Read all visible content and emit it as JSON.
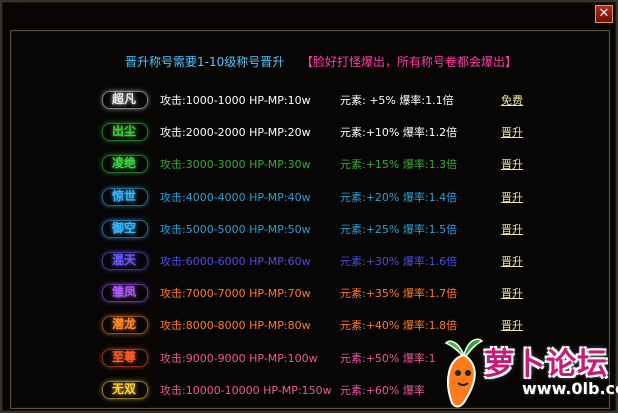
{
  "window": {
    "close_label": "✕"
  },
  "header": {
    "requirement": "晋升称号需要1-10级称号晋升",
    "notice": "【脸好打怪爆出，所有称号卷都会爆出】"
  },
  "titles": [
    {
      "name": "超凡",
      "attack": "攻击:1000-1000 HP-MP:10w",
      "element": "元素: +5% 爆率:1.1倍",
      "action": "免费",
      "color": "#e6e6e6",
      "text_color": "#ffffff"
    },
    {
      "name": "出尘",
      "attack": "攻击:2000-2000 HP-MP:20w",
      "element": "元素:+10% 爆率:1.2倍",
      "action": "晋升",
      "color": "#3fd23f",
      "text_color": "#ffffff"
    },
    {
      "name": "凌绝",
      "attack": "攻击:3000-3000 HP-MP:30w",
      "element": "元素:+15% 爆率:1.3倍",
      "action": "晋升",
      "color": "#3fd23f",
      "text_color": "#3aa83a"
    },
    {
      "name": "惊世",
      "attack": "攻击:4000-4000 HP-MP:40w",
      "element": "元素:+20% 爆率:1.4倍",
      "action": "晋升",
      "color": "#3ab8ff",
      "text_color": "#2a9fd8"
    },
    {
      "name": "御空",
      "attack": "攻击:5000-5000 HP-MP:50w",
      "element": "元素:+25% 爆率:1.5倍",
      "action": "晋升",
      "color": "#3ab8ff",
      "text_color": "#2a9fd8"
    },
    {
      "name": "混天",
      "attack": "攻击:6000-6000 HP-MP:60w",
      "element": "元素:+30% 爆率:1.6倍",
      "action": "晋升",
      "color": "#6a5cff",
      "text_color": "#4a4ee0"
    },
    {
      "name": "雏凤",
      "attack": "攻击:7000-7000 HP-MP:70w",
      "element": "元素:+35% 爆率:1.7倍",
      "action": "晋升",
      "color": "#b05cff",
      "text_color": "#ff7a2a"
    },
    {
      "name": "潜龙",
      "attack": "攻击:8000-8000 HP-MP:80w",
      "element": "元素:+40% 爆率:1.8倍",
      "action": "晋升",
      "color": "#ff8a2a",
      "text_color": "#ff7a2a"
    },
    {
      "name": "至尊",
      "attack": "攻击:9000-9000 HP-MP:100w",
      "element": "元素:+50% 爆率:1",
      "action": "",
      "color": "#ff5a2a",
      "text_color": "#e85aa0"
    },
    {
      "name": "无双",
      "attack": "攻击:10000-10000 HP-MP:150w",
      "element": "元素:+60% 爆率",
      "action": "",
      "color": "#ffd23a",
      "text_color": "#e85aa0"
    }
  ],
  "watermark": {
    "name": "萝卜论坛",
    "url": "www.0lb.com"
  }
}
